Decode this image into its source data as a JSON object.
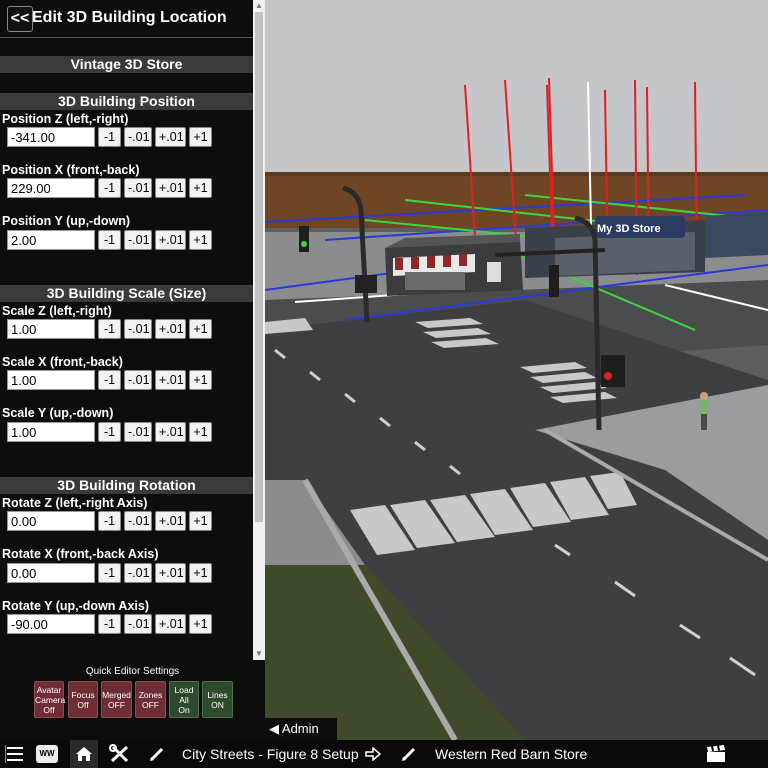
{
  "panel": {
    "back_label": "<<",
    "title": "Edit 3D Building Location",
    "building_name": "Vintage 3D Store"
  },
  "steps": [
    "-1",
    "-.01",
    "+.01",
    "+1"
  ],
  "sections": {
    "position": {
      "title": "3D Building Position",
      "fields": [
        {
          "label": "Position Z (left,-right)",
          "value": "-341.00"
        },
        {
          "label": "Position X (front,-back)",
          "value": "229.00"
        },
        {
          "label": "Position Y (up,-down)",
          "value": "2.00"
        }
      ]
    },
    "scale": {
      "title": "3D Building Scale (Size)",
      "fields": [
        {
          "label": "Scale Z (left,-right)",
          "value": "1.00"
        },
        {
          "label": "Scale X (front,-back)",
          "value": "1.00"
        },
        {
          "label": "Scale Y (up,-down)",
          "value": "1.00"
        }
      ]
    },
    "rotation": {
      "title": "3D Building Rotation",
      "fields": [
        {
          "label": "Rotate Z (left,-right Axis)",
          "value": "0.00"
        },
        {
          "label": "Rotate X (front,-back Axis)",
          "value": "0.00"
        },
        {
          "label": "Rotate Y (up,-down Axis)",
          "value": "-90.00"
        }
      ]
    }
  },
  "quick_settings": {
    "title": "Quick Editor Settings",
    "buttons": [
      {
        "line1": "Avatar",
        "line2": "Camera",
        "state": "Off",
        "color": "#6e2e34"
      },
      {
        "line1": "Focus",
        "line2": "",
        "state": "Off",
        "color": "#6e2e34"
      },
      {
        "line1": "Merged",
        "line2": "",
        "state": "OFF",
        "color": "#6e2e34"
      },
      {
        "line1": "Zones",
        "line2": "",
        "state": "OFF",
        "color": "#6e2e34"
      },
      {
        "line1": "Load",
        "line2": "All",
        "state": "On",
        "color": "#2e4a2e"
      },
      {
        "line1": "Lines",
        "line2": "",
        "state": "ON",
        "color": "#2e4a2e"
      }
    ]
  },
  "admin_tab": {
    "arrow": "◀",
    "label": "Admin"
  },
  "scene": {
    "store_sign": "My 3D Store"
  },
  "bottombar": {
    "menu_icon": "hamburger-icon",
    "logo_label": "WW",
    "home_icon": "home-icon",
    "tools_icon": "tools-icon",
    "edit_icon": "pencil-icon",
    "city_label": "City Streets - Figure 8 Setup",
    "go_icon": "arrow-right-icon",
    "store_edit_icon": "pencil-icon",
    "store_label": "Western Red Barn Store",
    "clapper_icon": "clapperboard-icon"
  }
}
